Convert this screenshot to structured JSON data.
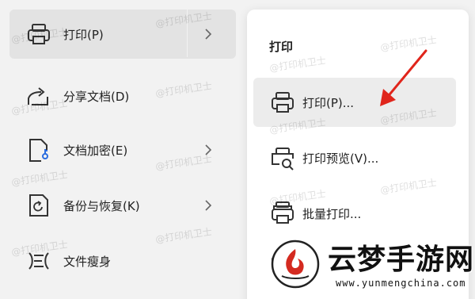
{
  "left_menu": {
    "items": [
      {
        "label": "打印(P)",
        "icon": "printer-icon",
        "has_submenu": true,
        "active": true
      },
      {
        "label": "分享文档(D)",
        "icon": "share-icon",
        "has_submenu": false
      },
      {
        "label": "文档加密(E)",
        "icon": "document-lock-icon",
        "has_submenu": true
      },
      {
        "label": "备份与恢复(K)",
        "icon": "backup-restore-icon",
        "has_submenu": true
      },
      {
        "label": "文件瘦身",
        "icon": "file-slim-icon",
        "has_submenu": false
      }
    ]
  },
  "submenu": {
    "title": "打印",
    "items": [
      {
        "label": "打印(P)...",
        "icon": "printer-icon",
        "active": true
      },
      {
        "label": "打印预览(V)...",
        "icon": "print-preview-icon"
      },
      {
        "label": "批量打印...",
        "icon": "batch-print-icon"
      }
    ]
  },
  "watermark": {
    "text": "@打印机卫士"
  },
  "logo": {
    "name": "云梦手游网",
    "url": "www.yunmengchina.com"
  },
  "colors": {
    "arrow": "#e0251b",
    "logo_red": "#d42a20",
    "active_bg": "#e3e3e3"
  }
}
